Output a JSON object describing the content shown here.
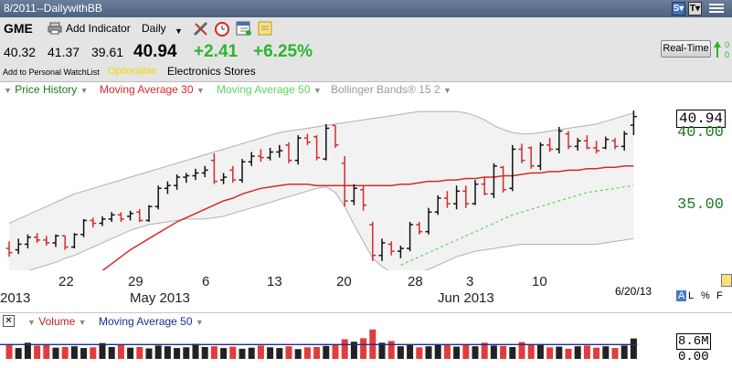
{
  "window": {
    "title": "8/2011--DailywithBB",
    "buttons": [
      "S▾",
      "T▾"
    ],
    "menu_icon": "list-icon"
  },
  "toolbar": {
    "symbol": "GME",
    "add_indicator": "Add Indicator",
    "period": "Daily",
    "icons": [
      "tools-icon",
      "clock-icon",
      "calendar-icon",
      "note-icon"
    ]
  },
  "quote": {
    "open": "40.32",
    "high": "41.37",
    "low": "39.61",
    "last": "40.94",
    "change": "+2.41",
    "change_pct": "+6.25%",
    "add_watchlist": "Add to Personal WatchList",
    "optionable": "Optionable",
    "industry": "Electronics Stores",
    "realtime": "Real-Time",
    "side_values": [
      "0",
      "0"
    ],
    "change_color": "#2db52d",
    "optionable_color": "#f0d800"
  },
  "legend": {
    "price_history": "Price History",
    "ma30": "Moving Average 30",
    "ma50": "Moving Average 50",
    "bb": "Bollinger Bands® 15 2",
    "colors": {
      "price": "#1a7a1a",
      "ma30": "#d42a2a",
      "ma50": "#5cd65c",
      "bb": "#9a9a9a"
    }
  },
  "axes": {
    "date_labels": [
      "2013",
      "22",
      "29",
      "May 2013",
      "6",
      "13",
      "20",
      "28",
      "3",
      "Jun 2013",
      "10"
    ],
    "price_labels": [
      "40.94",
      "40.00",
      "35.00"
    ],
    "current_date": "6/20/13",
    "controls": [
      "A",
      "L",
      "%",
      "F"
    ]
  },
  "chart_data": {
    "type": "ohlc",
    "period": "daily, Apr 2013 – Jun 20 2013",
    "y_visible_range": [
      30.5,
      42.5
    ],
    "last": 40.94,
    "bars": [
      {
        "o": 31.5,
        "h": 32.0,
        "l": 30.9,
        "c": 31.2
      },
      {
        "o": 31.4,
        "h": 32.2,
        "l": 31.1,
        "c": 31.8
      },
      {
        "o": 31.8,
        "h": 32.5,
        "l": 31.5,
        "c": 32.3
      },
      {
        "o": 32.3,
        "h": 32.6,
        "l": 31.9,
        "c": 32.1
      },
      {
        "o": 32.1,
        "h": 32.4,
        "l": 31.7,
        "c": 31.9
      },
      {
        "o": 31.9,
        "h": 32.5,
        "l": 31.6,
        "c": 32.4
      },
      {
        "o": 32.4,
        "h": 32.4,
        "l": 31.4,
        "c": 31.6
      },
      {
        "o": 31.6,
        "h": 32.6,
        "l": 31.5,
        "c": 32.5
      },
      {
        "o": 32.5,
        "h": 33.6,
        "l": 32.3,
        "c": 33.5
      },
      {
        "o": 33.5,
        "h": 33.7,
        "l": 33.0,
        "c": 33.3
      },
      {
        "o": 33.3,
        "h": 33.8,
        "l": 33.1,
        "c": 33.6
      },
      {
        "o": 33.6,
        "h": 34.1,
        "l": 33.4,
        "c": 33.9
      },
      {
        "o": 33.9,
        "h": 34.1,
        "l": 33.4,
        "c": 33.6
      },
      {
        "o": 33.8,
        "h": 34.2,
        "l": 33.5,
        "c": 34.0
      },
      {
        "o": 34.1,
        "h": 34.3,
        "l": 33.4,
        "c": 33.5
      },
      {
        "o": 33.5,
        "h": 34.6,
        "l": 33.4,
        "c": 34.5
      },
      {
        "o": 34.5,
        "h": 36.0,
        "l": 34.3,
        "c": 35.8
      },
      {
        "o": 35.8,
        "h": 36.3,
        "l": 35.4,
        "c": 36.0
      },
      {
        "o": 36.0,
        "h": 36.8,
        "l": 35.7,
        "c": 36.6
      },
      {
        "o": 36.6,
        "h": 36.9,
        "l": 36.2,
        "c": 36.7
      },
      {
        "o": 36.7,
        "h": 37.2,
        "l": 36.4,
        "c": 36.9
      },
      {
        "o": 36.9,
        "h": 37.4,
        "l": 36.6,
        "c": 37.1
      },
      {
        "o": 37.8,
        "h": 38.3,
        "l": 36.1,
        "c": 36.3
      },
      {
        "o": 36.4,
        "h": 36.9,
        "l": 36.1,
        "c": 36.6
      },
      {
        "o": 37.1,
        "h": 37.4,
        "l": 36.2,
        "c": 36.4
      },
      {
        "o": 36.4,
        "h": 37.9,
        "l": 36.2,
        "c": 37.7
      },
      {
        "o": 37.7,
        "h": 38.4,
        "l": 37.4,
        "c": 38.1
      },
      {
        "o": 38.1,
        "h": 38.6,
        "l": 37.7,
        "c": 38.0
      },
      {
        "o": 38.0,
        "h": 38.7,
        "l": 37.8,
        "c": 38.4
      },
      {
        "o": 38.4,
        "h": 38.9,
        "l": 38.0,
        "c": 38.5
      },
      {
        "o": 38.9,
        "h": 39.1,
        "l": 37.6,
        "c": 37.8
      },
      {
        "o": 37.8,
        "h": 39.6,
        "l": 37.5,
        "c": 39.4
      },
      {
        "o": 39.4,
        "h": 39.7,
        "l": 38.9,
        "c": 39.1
      },
      {
        "o": 39.5,
        "h": 39.6,
        "l": 37.8,
        "c": 38.0
      },
      {
        "o": 37.9,
        "h": 40.4,
        "l": 37.8,
        "c": 40.1
      },
      {
        "o": 40.3,
        "h": 40.3,
        "l": 38.7,
        "c": 38.9
      },
      {
        "o": 37.6,
        "h": 38.1,
        "l": 34.5,
        "c": 34.9
      },
      {
        "o": 34.9,
        "h": 36.1,
        "l": 34.6,
        "c": 35.8
      },
      {
        "o": 35.7,
        "h": 36.0,
        "l": 34.2,
        "c": 34.6
      },
      {
        "o": 33.2,
        "h": 33.4,
        "l": 30.6,
        "c": 31.0
      },
      {
        "o": 31.0,
        "h": 32.2,
        "l": 30.6,
        "c": 31.9
      },
      {
        "o": 31.8,
        "h": 32.0,
        "l": 31.0,
        "c": 31.3
      },
      {
        "o": 31.3,
        "h": 31.7,
        "l": 30.8,
        "c": 31.5
      },
      {
        "o": 31.5,
        "h": 33.4,
        "l": 31.3,
        "c": 33.2
      },
      {
        "o": 33.2,
        "h": 33.4,
        "l": 32.5,
        "c": 32.7
      },
      {
        "o": 32.7,
        "h": 34.4,
        "l": 32.5,
        "c": 34.1
      },
      {
        "o": 34.1,
        "h": 35.3,
        "l": 33.9,
        "c": 35.1
      },
      {
        "o": 35.1,
        "h": 35.6,
        "l": 34.4,
        "c": 34.7
      },
      {
        "o": 34.7,
        "h": 36.0,
        "l": 34.3,
        "c": 35.6
      },
      {
        "o": 35.6,
        "h": 36.0,
        "l": 34.4,
        "c": 34.7
      },
      {
        "o": 34.7,
        "h": 36.4,
        "l": 34.6,
        "c": 36.1
      },
      {
        "o": 36.1,
        "h": 36.6,
        "l": 35.3,
        "c": 35.4
      },
      {
        "o": 35.4,
        "h": 37.6,
        "l": 35.1,
        "c": 37.4
      },
      {
        "o": 37.3,
        "h": 37.4,
        "l": 35.5,
        "c": 35.7
      },
      {
        "o": 35.8,
        "h": 38.9,
        "l": 35.6,
        "c": 38.6
      },
      {
        "o": 38.6,
        "h": 39.0,
        "l": 37.6,
        "c": 37.8
      },
      {
        "o": 38.7,
        "h": 38.8,
        "l": 37.2,
        "c": 37.4
      },
      {
        "o": 37.4,
        "h": 39.1,
        "l": 37.1,
        "c": 38.9
      },
      {
        "o": 38.9,
        "h": 39.4,
        "l": 38.4,
        "c": 38.6
      },
      {
        "o": 38.6,
        "h": 40.2,
        "l": 38.3,
        "c": 39.9
      },
      {
        "o": 39.7,
        "h": 39.9,
        "l": 38.6,
        "c": 38.8
      },
      {
        "o": 38.8,
        "h": 39.4,
        "l": 38.5,
        "c": 39.2
      },
      {
        "o": 39.2,
        "h": 39.6,
        "l": 38.6,
        "c": 38.7
      },
      {
        "o": 38.7,
        "h": 39.2,
        "l": 38.3,
        "c": 38.5
      },
      {
        "o": 38.7,
        "h": 39.5,
        "l": 38.6,
        "c": 39.3
      },
      {
        "o": 39.2,
        "h": 39.4,
        "l": 38.6,
        "c": 38.8
      },
      {
        "o": 38.8,
        "h": 39.9,
        "l": 38.5,
        "c": 39.7
      },
      {
        "o": 40.32,
        "h": 41.37,
        "l": 39.61,
        "c": 40.94
      }
    ],
    "ma30": [
      24.5,
      25.0,
      25.6,
      26.1,
      26.7,
      27.3,
      27.9,
      28.5,
      29.0,
      29.5,
      29.9,
      30.4,
      30.9,
      31.4,
      31.8,
      32.2,
      32.6,
      33.0,
      33.4,
      33.7,
      34.0,
      34.3,
      34.6,
      34.9,
      35.1,
      35.4,
      35.6,
      35.8,
      35.9,
      36.0,
      36.1,
      36.1,
      36.1,
      36.0,
      36.0,
      36.0,
      36.0,
      36.0,
      36.0,
      36.0,
      36.0,
      36.0,
      36.1,
      36.1,
      36.2,
      36.3,
      36.3,
      36.4,
      36.4,
      36.5,
      36.5,
      36.6,
      36.6,
      36.7,
      36.7,
      36.8,
      36.9,
      36.9,
      37.0,
      37.0,
      37.1,
      37.1,
      37.2,
      37.2,
      37.3,
      37.3,
      37.4,
      37.4
    ],
    "ma50": [
      null,
      null,
      null,
      null,
      null,
      null,
      null,
      null,
      null,
      null,
      null,
      null,
      null,
      null,
      null,
      null,
      null,
      null,
      null,
      null,
      null,
      null,
      null,
      null,
      null,
      null,
      null,
      null,
      null,
      null,
      null,
      null,
      null,
      null,
      null,
      null,
      null,
      null,
      null,
      null,
      null,
      null,
      30.3,
      30.6,
      30.9,
      31.2,
      31.5,
      31.8,
      32.1,
      32.4,
      32.7,
      33.0,
      33.3,
      33.6,
      33.9,
      34.1,
      34.3,
      34.5,
      34.7,
      34.9,
      35.1,
      35.3,
      35.5,
      35.6,
      35.7,
      35.8,
      35.9,
      36.0
    ],
    "bb_upper": [
      33.3,
      33.6,
      33.9,
      34.2,
      34.5,
      34.8,
      35.1,
      35.4,
      35.6,
      35.8,
      36.0,
      36.2,
      36.4,
      36.6,
      36.8,
      37.0,
      37.2,
      37.4,
      37.6,
      37.8,
      38.0,
      38.2,
      38.4,
      38.6,
      38.8,
      39.0,
      39.2,
      39.4,
      39.6,
      39.8,
      39.9,
      40.0,
      40.1,
      40.2,
      40.3,
      40.4,
      40.5,
      40.6,
      40.7,
      40.8,
      40.9,
      41.0,
      41.1,
      41.2,
      41.3,
      41.3,
      41.3,
      41.3,
      41.3,
      41.2,
      41.0,
      40.7,
      40.3,
      40.0,
      39.8,
      39.7,
      39.7,
      39.8,
      39.9,
      40.0,
      40.1,
      40.2,
      40.3,
      40.4,
      40.6,
      40.8,
      41.0,
      41.2
    ],
    "bb_lower": [
      29.5,
      29.7,
      29.9,
      30.1,
      30.3,
      30.5,
      30.8,
      31.0,
      31.3,
      31.6,
      31.9,
      32.2,
      32.5,
      32.8,
      33.0,
      33.2,
      33.3,
      33.4,
      33.5,
      33.6,
      33.6,
      33.6,
      33.7,
      33.8,
      34.0,
      34.2,
      34.4,
      34.6,
      34.8,
      35.0,
      35.2,
      35.4,
      35.6,
      35.8,
      35.9,
      35.5,
      34.5,
      33.2,
      32.0,
      30.8,
      30.2,
      29.8,
      29.6,
      29.6,
      29.8,
      30.0,
      30.3,
      30.6,
      30.9,
      31.1,
      31.3,
      31.4,
      31.5,
      31.6,
      31.7,
      31.8,
      31.8,
      31.8,
      31.8,
      31.8,
      31.8,
      31.8,
      31.8,
      31.8,
      31.9,
      32.0,
      32.1,
      32.2
    ]
  },
  "volume": {
    "title": "Volume",
    "ma50": "Moving Average 50",
    "labels": [
      "8.6M",
      "0.00"
    ],
    "volumes_m": [
      4.2,
      3.1,
      4.6,
      3.8,
      3.9,
      3.2,
      3.4,
      3.6,
      3.1,
      3.3,
      4.5,
      3.4,
      3.9,
      3.2,
      3.4,
      3.0,
      3.8,
      3.6,
      3.1,
      3.3,
      4.3,
      3.4,
      3.6,
      3.1,
      3.5,
      2.9,
      3.2,
      3.8,
      3.3,
      3.1,
      3.6,
      2.8,
      3.3,
      3.4,
      3.7,
      4.1,
      5.6,
      4.9,
      5.9,
      8.4,
      4.6,
      5.1,
      3.6,
      3.9,
      3.3,
      3.6,
      4.1,
      3.9,
      3.5,
      4.2,
      3.6,
      4.6,
      3.8,
      3.7,
      3.4,
      4.8,
      3.9,
      4.1,
      3.3,
      3.5,
      2.9,
      3.6,
      3.8,
      3.2,
      3.6,
      3.1,
      3.8,
      5.8
    ],
    "vol_ma": 4.1,
    "up_color": "#222222",
    "down_color": "#e03c3c"
  }
}
